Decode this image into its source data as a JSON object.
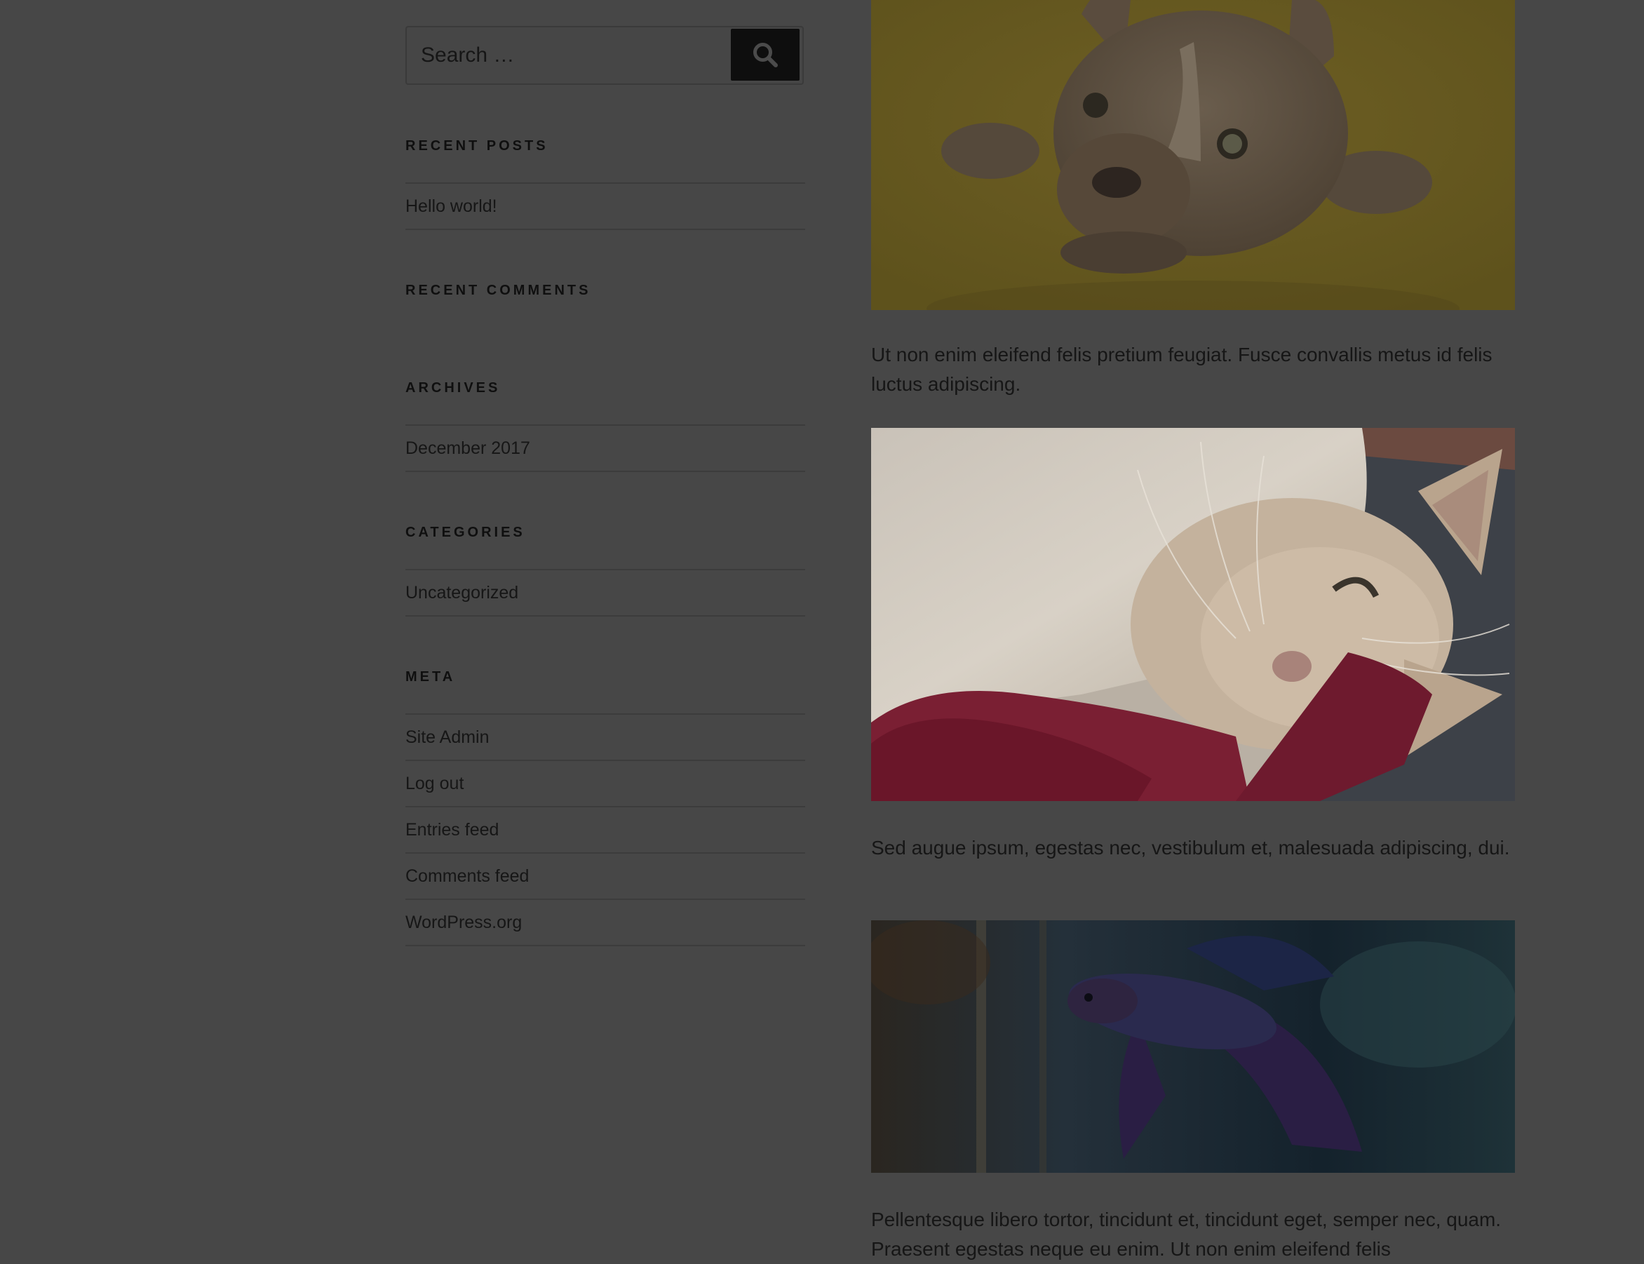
{
  "search": {
    "placeholder": "Search …",
    "button_icon": "search-icon"
  },
  "sidebar": {
    "recent_posts": {
      "title": "RECENT POSTS",
      "items": [
        "Hello world!"
      ]
    },
    "recent_comments": {
      "title": "RECENT COMMENTS",
      "items": []
    },
    "archives": {
      "title": "ARCHIVES",
      "items": [
        "December 2017"
      ]
    },
    "categories": {
      "title": "CATEGORIES",
      "items": [
        "Uncategorized"
      ]
    },
    "meta": {
      "title": "META",
      "items": [
        "Site Admin",
        "Log out",
        "Entries feed",
        "Comments feed",
        "WordPress.org"
      ]
    }
  },
  "post": {
    "paragraphs": [
      "Ut non enim eleifend felis pretium feugiat. Fusce convallis metus id felis luctus adipiscing.",
      "Sed augue ipsum, egestas nec, vestibulum et, malesuada adipiscing, dui.",
      "Pellentesque libero tortor, tincidunt et, tincidunt eget, semper nec, quam. Praesent egestas neque eu enim. Ut non enim eleifend felis"
    ]
  },
  "colors": {
    "overlay_background": "#474747",
    "text": "#161616",
    "button": "#0e0e0e"
  }
}
